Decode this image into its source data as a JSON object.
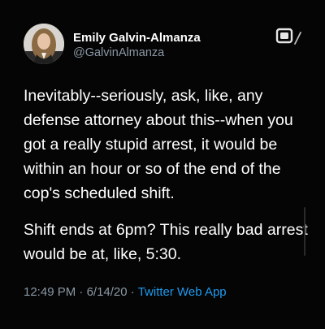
{
  "author": {
    "display_name": "Emily Galvin-Almanza",
    "handle": "@GalvinAlmanza"
  },
  "tweet": {
    "paragraphs": [
      "Inevitably--seriously, ask, like, any defense attorney about this--when you got a really stupid arrest, it would be within an hour or so of the end of the cop's scheduled shift.",
      "Shift ends at 6pm? This really bad arrest would be at, like, 5:30."
    ],
    "time": "12:49 PM",
    "date": "6/14/20",
    "separator": "·",
    "source": "Twitter Web App"
  },
  "icons": {
    "avatar": "profile-photo",
    "share": "share-icon"
  },
  "colors": {
    "background": "#050505",
    "text": "#ffffff",
    "secondary_text": "#8b98a5",
    "link": "#1d9bf0"
  }
}
